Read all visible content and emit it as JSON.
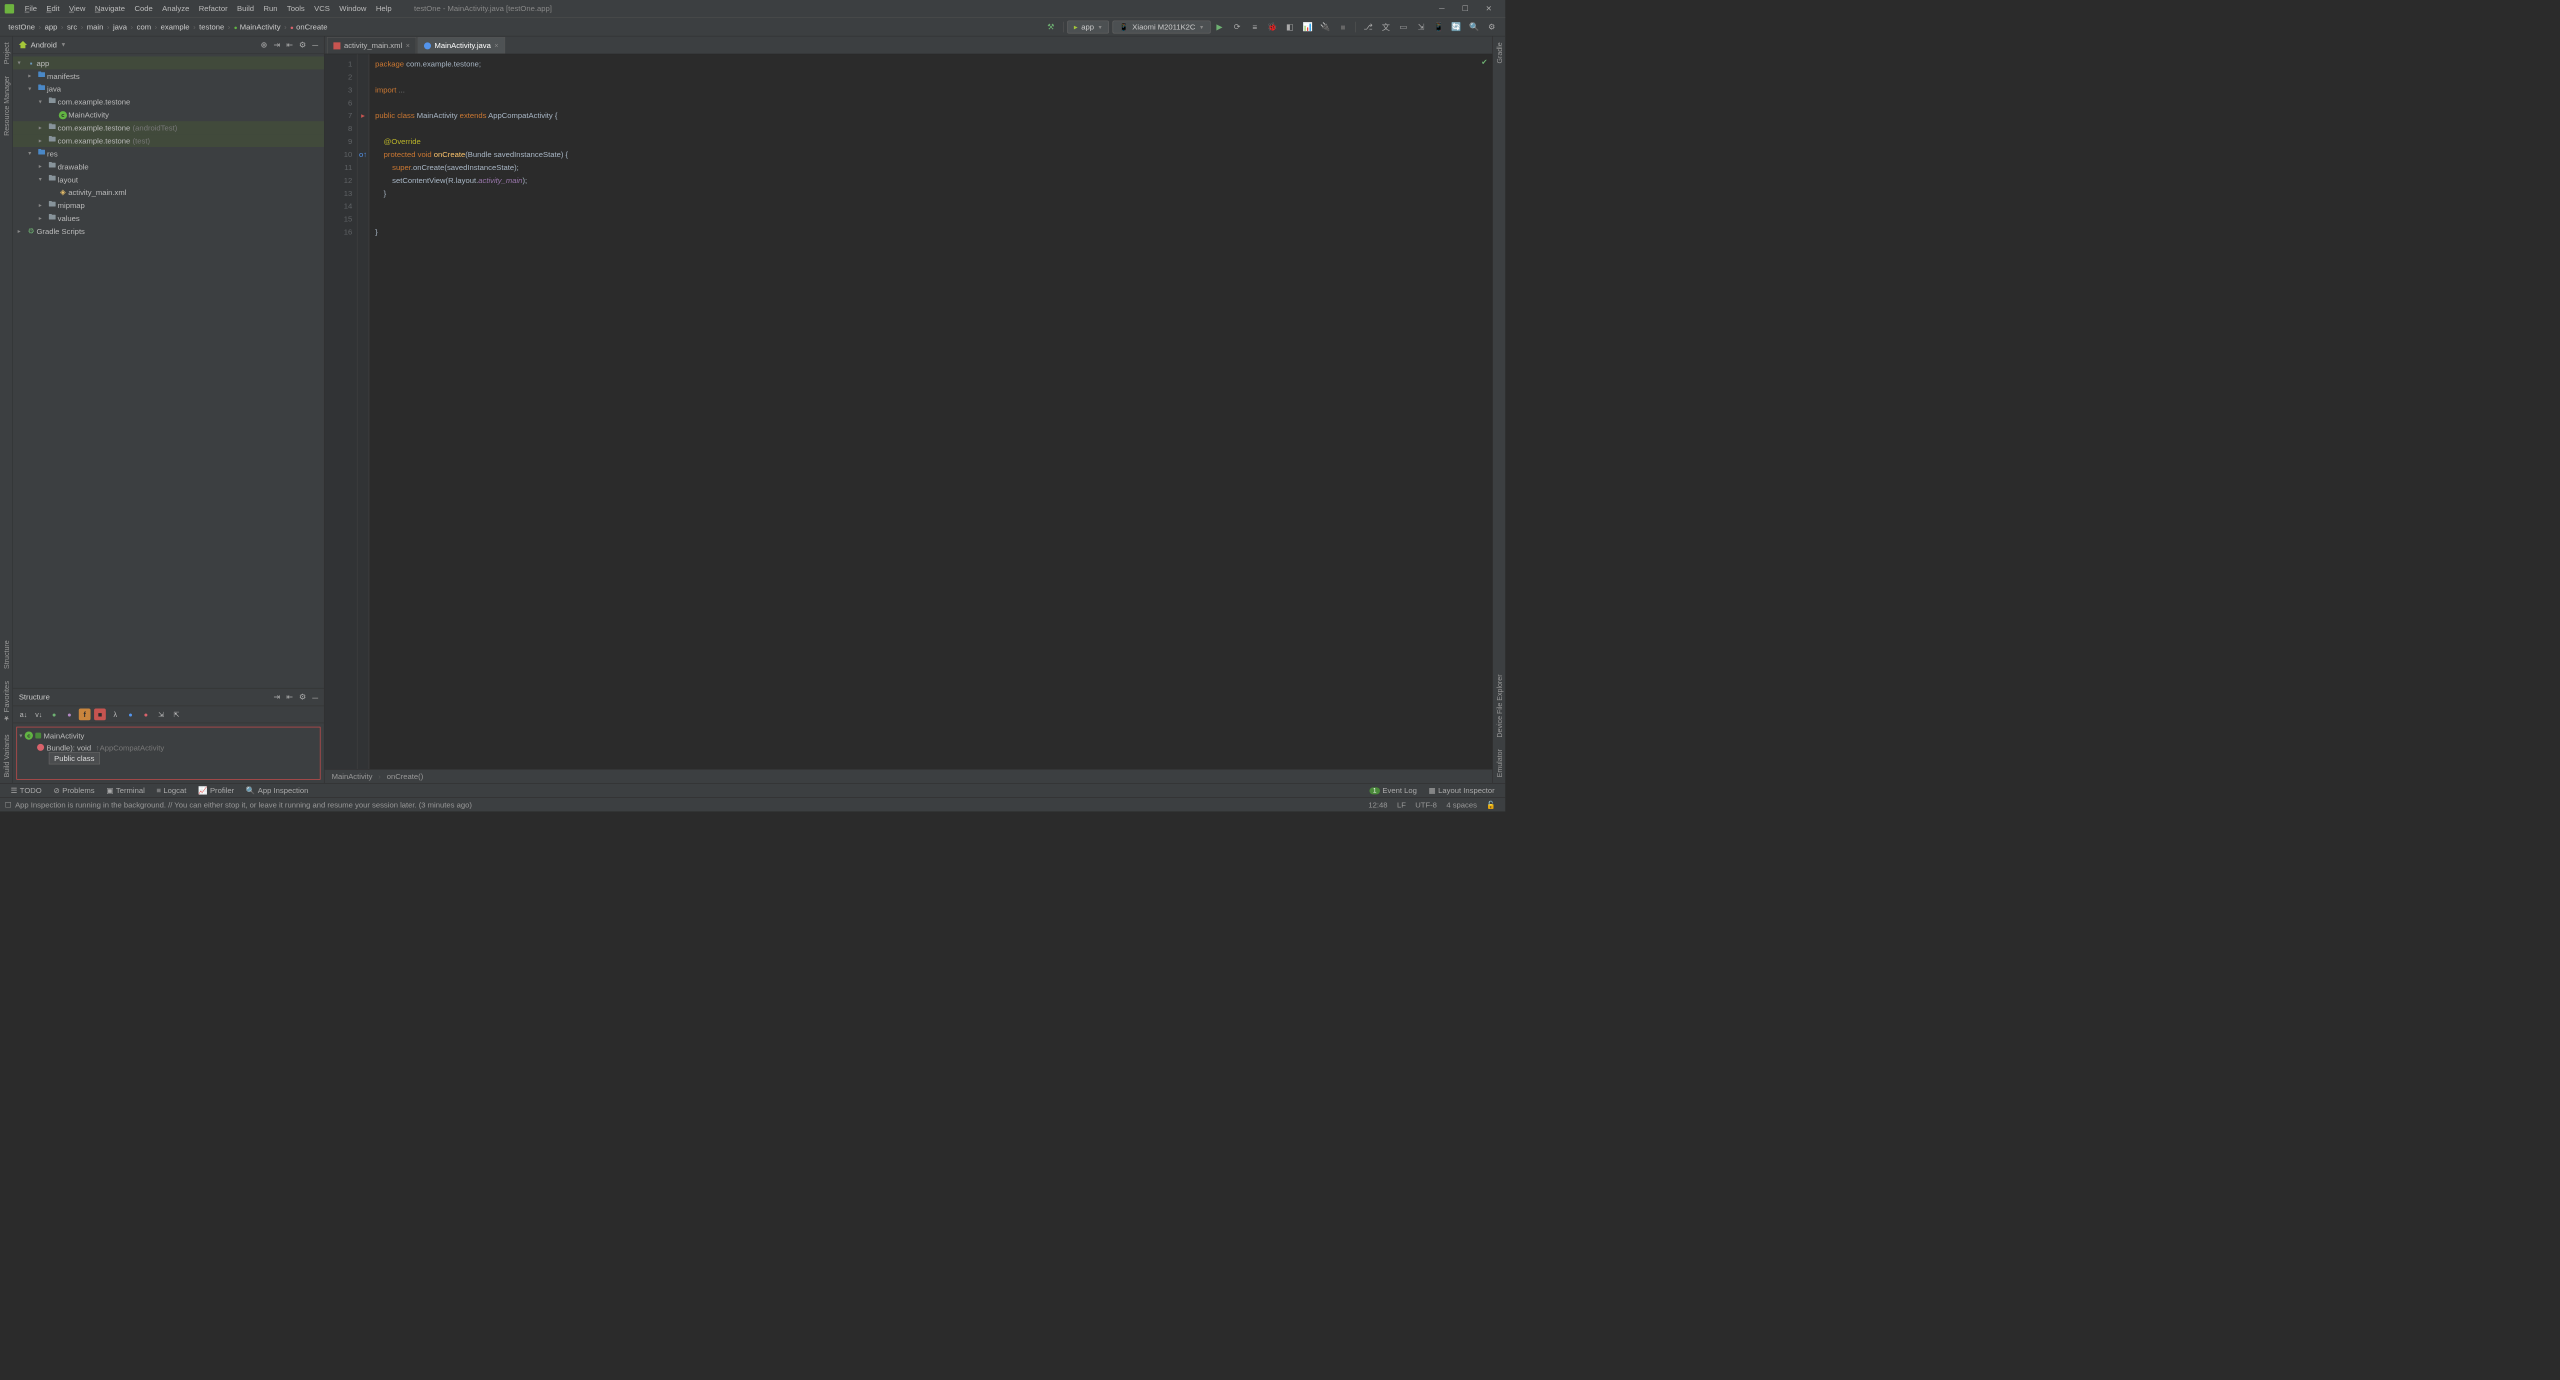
{
  "window": {
    "title": "testOne - MainActivity.java [testOne.app]"
  },
  "menu": {
    "file": "File",
    "edit": "Edit",
    "view": "View",
    "navigate": "Navigate",
    "code": "Code",
    "analyze": "Analyze",
    "refactor": "Refactor",
    "build": "Build",
    "run": "Run",
    "tools": "Tools",
    "vcs": "VCS",
    "window": "Window",
    "help": "Help"
  },
  "breadcrumbs": [
    "testOne",
    "app",
    "src",
    "main",
    "java",
    "com",
    "example",
    "testone",
    "MainActivity",
    "onCreate"
  ],
  "runconfig": {
    "module": "app",
    "device": "Xiaomi M2011K2C"
  },
  "project_panel": {
    "title": "Android",
    "tree": [
      {
        "depth": 0,
        "arrow": "▾",
        "icon": "mod",
        "label": "app",
        "hl": true
      },
      {
        "depth": 1,
        "arrow": "▸",
        "icon": "folder-blue",
        "label": "manifests"
      },
      {
        "depth": 1,
        "arrow": "▾",
        "icon": "folder-blue",
        "label": "java"
      },
      {
        "depth": 2,
        "arrow": "▾",
        "icon": "folder",
        "label": "com.example.testone"
      },
      {
        "depth": 3,
        "arrow": "",
        "icon": "class",
        "label": "MainActivity"
      },
      {
        "depth": 2,
        "arrow": "▸",
        "icon": "folder",
        "label": "com.example.testone",
        "suffix": "(androidTest)",
        "hl": true,
        "sel": true
      },
      {
        "depth": 2,
        "arrow": "▸",
        "icon": "folder",
        "label": "com.example.testone",
        "suffix": "(test)",
        "hl": true
      },
      {
        "depth": 1,
        "arrow": "▾",
        "icon": "folder-blue",
        "label": "res"
      },
      {
        "depth": 2,
        "arrow": "▸",
        "icon": "folder",
        "label": "drawable"
      },
      {
        "depth": 2,
        "arrow": "▾",
        "icon": "folder",
        "label": "layout"
      },
      {
        "depth": 3,
        "arrow": "",
        "icon": "xml",
        "label": "activity_main.xml"
      },
      {
        "depth": 2,
        "arrow": "▸",
        "icon": "folder",
        "label": "mipmap"
      },
      {
        "depth": 2,
        "arrow": "▸",
        "icon": "folder",
        "label": "values"
      },
      {
        "depth": 0,
        "arrow": "▸",
        "icon": "gradle",
        "label": "Gradle Scripts"
      }
    ]
  },
  "structure": {
    "title": "Structure",
    "main": "MainActivity",
    "method": "Bundle): void",
    "inherit": "↑AppCompatActivity",
    "tooltip": "Public class"
  },
  "tabs": [
    {
      "icon": "xml",
      "label": "activity_main.xml",
      "active": false
    },
    {
      "icon": "c",
      "label": "MainActivity.java",
      "active": true
    }
  ],
  "code": {
    "lines": [
      1,
      2,
      3,
      6,
      7,
      8,
      9,
      10,
      11,
      12,
      13,
      14,
      15,
      16
    ],
    "l1": {
      "a": "package ",
      "b": "com.example.testone;"
    },
    "l3": {
      "a": "import ",
      "b": "..."
    },
    "l7": {
      "a": "public class ",
      "b": "MainActivity ",
      "c": "extends ",
      "d": "AppCompatActivity {"
    },
    "l9": "@Override",
    "l10": {
      "a": "protected void ",
      "b": "onCreate",
      "c": "(Bundle savedInstanceState) {"
    },
    "l11": {
      "a": "super",
      "b": ".onCreate(savedInstanceState);"
    },
    "l12": {
      "a": "setContentView(R.layout.",
      "b": "activity_main",
      "c": ");"
    },
    "l13": "}",
    "l16": "}"
  },
  "crumbbar": {
    "a": "MainActivity",
    "b": "onCreate()"
  },
  "leftrail": [
    "Project",
    "Resource Manager"
  ],
  "leftrail2": [
    "Structure",
    "Favorites",
    "Build Variants"
  ],
  "rightrail": [
    "Gradle",
    "Device File Explorer",
    "Emulator"
  ],
  "bottom": {
    "todo": "TODO",
    "problems": "Problems",
    "terminal": "Terminal",
    "logcat": "Logcat",
    "profiler": "Profiler",
    "appinsp": "App Inspection",
    "eventlog": "Event Log",
    "layoutinsp": "Layout Inspector",
    "badge": "1"
  },
  "status": {
    "msg": "App Inspection is running in the background. // You can either stop it, or leave it running and resume your session later. (3 minutes ago)",
    "pos": "12:48",
    "lf": "LF",
    "enc": "UTF-8",
    "indent": "4 spaces"
  }
}
